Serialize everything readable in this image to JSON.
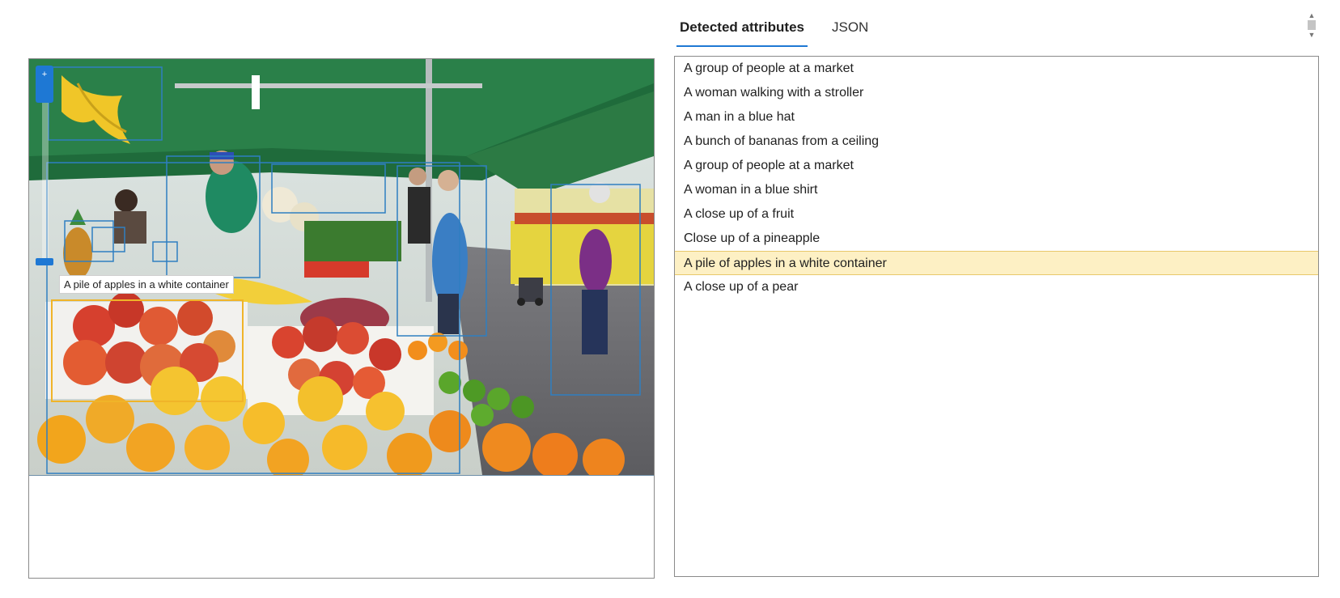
{
  "tabs": [
    {
      "label": "Detected attributes",
      "active": true
    },
    {
      "label": "JSON",
      "active": false
    }
  ],
  "image": {
    "description_icon": "market-photo",
    "tooltip": "A pile of apples in a white container",
    "box_color": "#2f7fc1",
    "selected_box_color": "#f0b429"
  },
  "zoom": {
    "zoom_in_icon": "plus-icon",
    "level": 1.0
  },
  "attributes": [
    {
      "label": "A group of people at a market",
      "selected": false
    },
    {
      "label": "A woman walking with a stroller",
      "selected": false
    },
    {
      "label": "A man in a blue hat",
      "selected": false
    },
    {
      "label": "A bunch of bananas from a ceiling",
      "selected": false
    },
    {
      "label": "A group of people at a market",
      "selected": false
    },
    {
      "label": "A woman in a blue shirt",
      "selected": false
    },
    {
      "label": "A close up of a fruit",
      "selected": false
    },
    {
      "label": "Close up of a pineapple",
      "selected": false
    },
    {
      "label": "A pile of apples in a white container",
      "selected": true
    },
    {
      "label": "A close up of a pear",
      "selected": false
    }
  ],
  "colors": {
    "accent": "#1e78d4",
    "selected_bg": "#fdf0c4"
  }
}
